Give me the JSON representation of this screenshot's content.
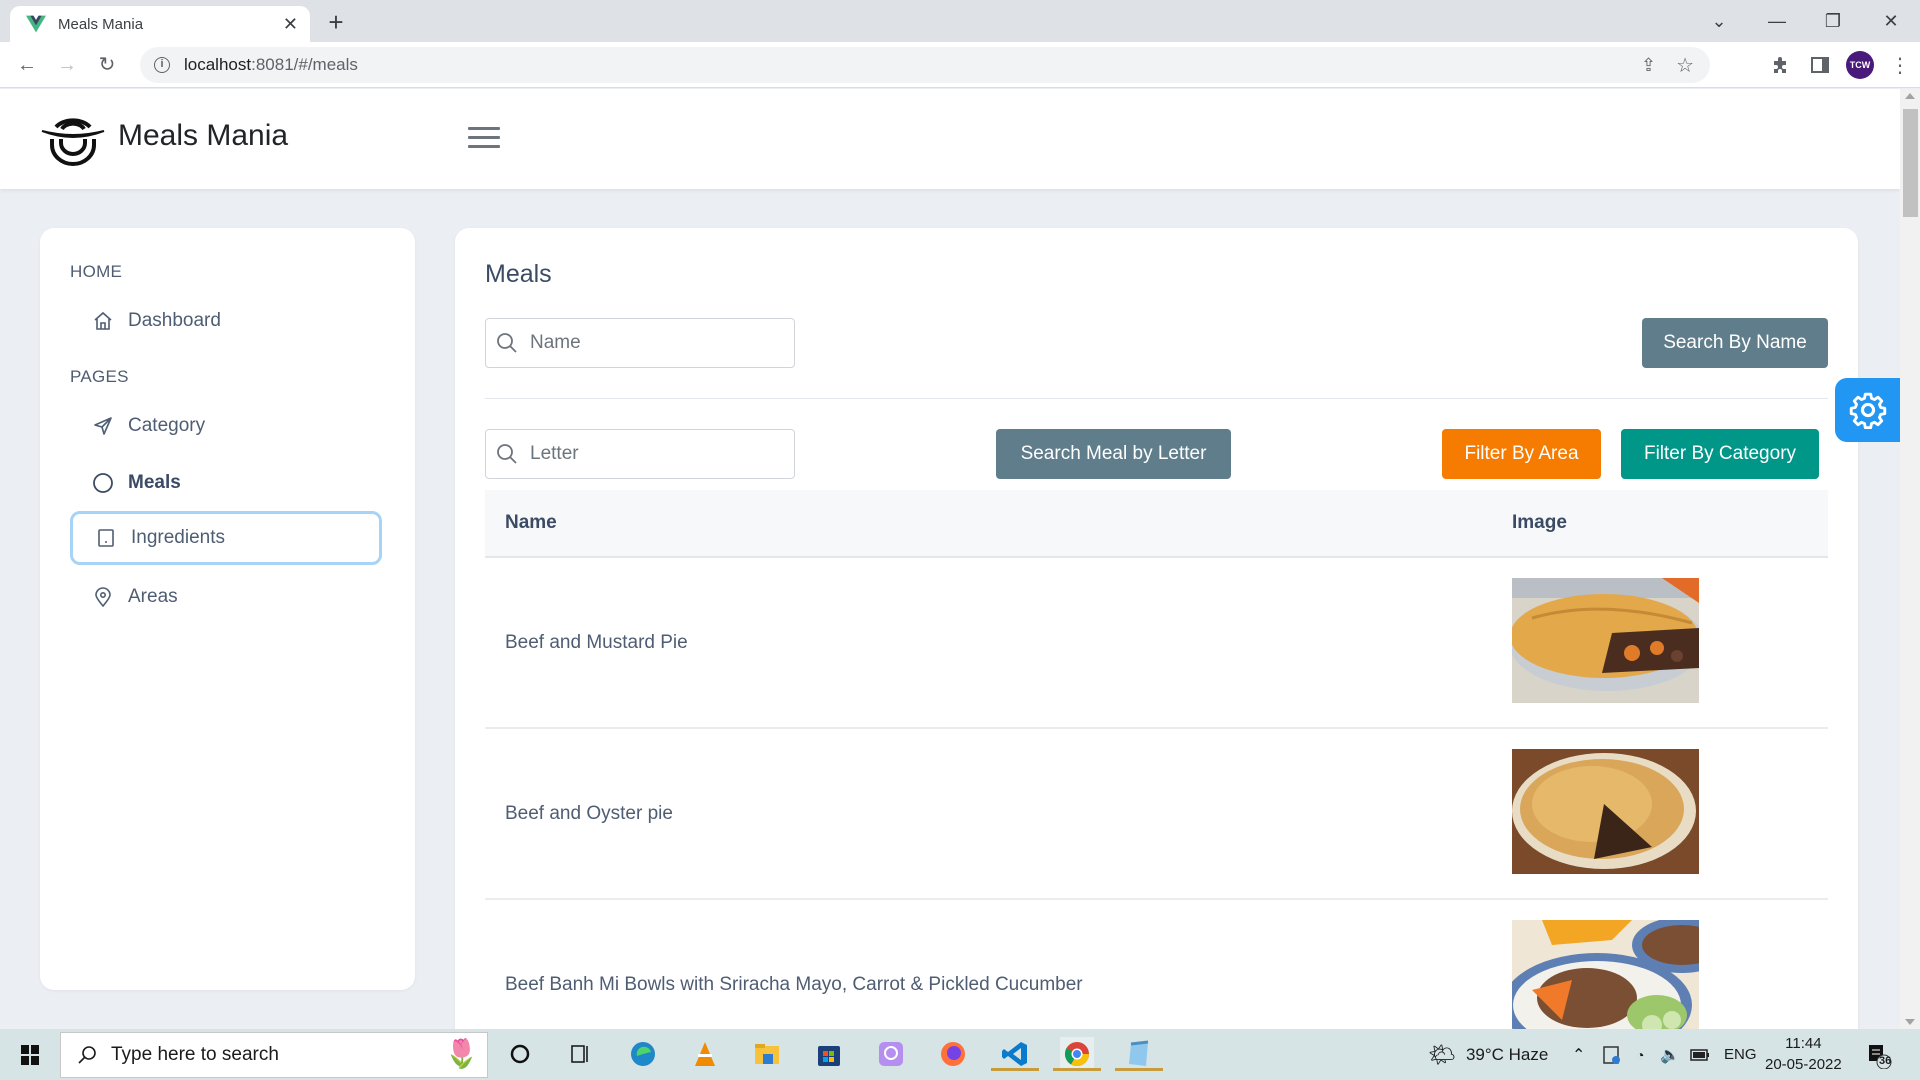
{
  "browser": {
    "tab_title": "Meals Mania",
    "url_host": "localhost",
    "url_path": ":8081/#/meals",
    "avatar_text": "TCW"
  },
  "header": {
    "brand": "Meals Mania"
  },
  "sidebar": {
    "sections": [
      {
        "label": "HOME",
        "items": [
          {
            "label": "Dashboard",
            "icon": "home-icon"
          }
        ]
      },
      {
        "label": "PAGES",
        "items": [
          {
            "label": "Category",
            "icon": "paper-plane-icon"
          },
          {
            "label": "Meals",
            "icon": "circle-icon",
            "active": true
          },
          {
            "label": "Ingredients",
            "icon": "tablet-icon",
            "focused": true
          },
          {
            "label": "Areas",
            "icon": "location-pin-icon"
          }
        ]
      }
    ]
  },
  "main": {
    "title": "Meals",
    "name_input": {
      "placeholder": "Name",
      "value": ""
    },
    "letter_input": {
      "placeholder": "Letter",
      "value": ""
    },
    "buttons": {
      "search_by_name": "Search By Name",
      "search_by_letter": "Search Meal by Letter",
      "filter_by_area": "Filter By Area",
      "filter_by_category": "Filter By Category"
    },
    "colors": {
      "grey_button": "#607d8b",
      "orange_button": "#f57c00",
      "teal_button": "#009688",
      "settings_fab": "#2196f3"
    },
    "table": {
      "columns": [
        "Name",
        "Image"
      ],
      "rows": [
        {
          "name": "Beef and Mustard Pie",
          "image": "beef-mustard-pie-photo"
        },
        {
          "name": "Beef and Oyster pie",
          "image": "beef-oyster-pie-photo"
        },
        {
          "name": "Beef Banh Mi Bowls with Sriracha Mayo, Carrot & Pickled Cucumber",
          "image": "beef-banh-mi-bowl-photo"
        }
      ]
    }
  },
  "taskbar": {
    "search_placeholder": "Type here to search",
    "weather": "39°C  Haze",
    "language": "ENG",
    "time": "11:44",
    "date": "20-05-2022",
    "notifications": "36"
  }
}
